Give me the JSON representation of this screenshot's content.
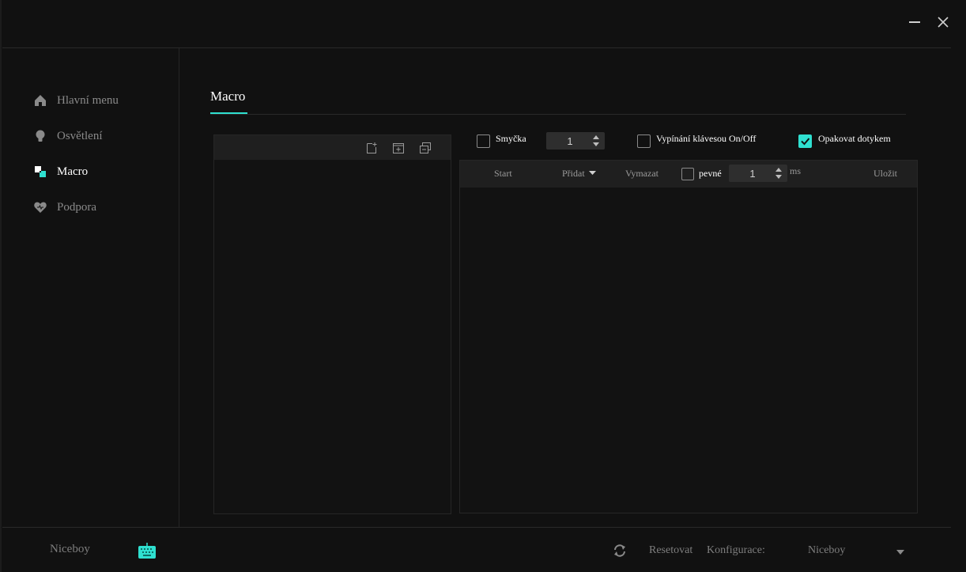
{
  "sidebar": {
    "items": [
      {
        "label": "Hlavní menu",
        "icon": "home-icon"
      },
      {
        "label": "Osvětlení",
        "icon": "bulb-icon"
      },
      {
        "label": "Macro",
        "icon": "macro-icon"
      },
      {
        "label": "Podpora",
        "icon": "heart-icon"
      }
    ],
    "active_index": 2
  },
  "main": {
    "tab_label": "Macro"
  },
  "options": {
    "loop_label": "Smyčka",
    "loop_checked": false,
    "loop_count": "1",
    "key_toggle_label": "Vypínání klávesou On/Off",
    "key_toggle_checked": false,
    "repeat_touch_label": "Opakovat dotykem",
    "repeat_touch_checked": true
  },
  "macro_toolbar": {
    "start_label": "Start",
    "add_label": "Přidat",
    "delete_label": "Vymazat",
    "fixed_label": "pevné",
    "fixed_checked": false,
    "delay_value": "1",
    "delay_unit": "ms",
    "save_label": "Uložit"
  },
  "footer": {
    "brand": "Niceboy",
    "reset_label": "Resetovat",
    "config_label": "Konfigurace:",
    "config_value": "Niceboy"
  },
  "colors": {
    "accent": "#2fe0d0",
    "background": "#111111",
    "panel": "#1f1f1f"
  }
}
